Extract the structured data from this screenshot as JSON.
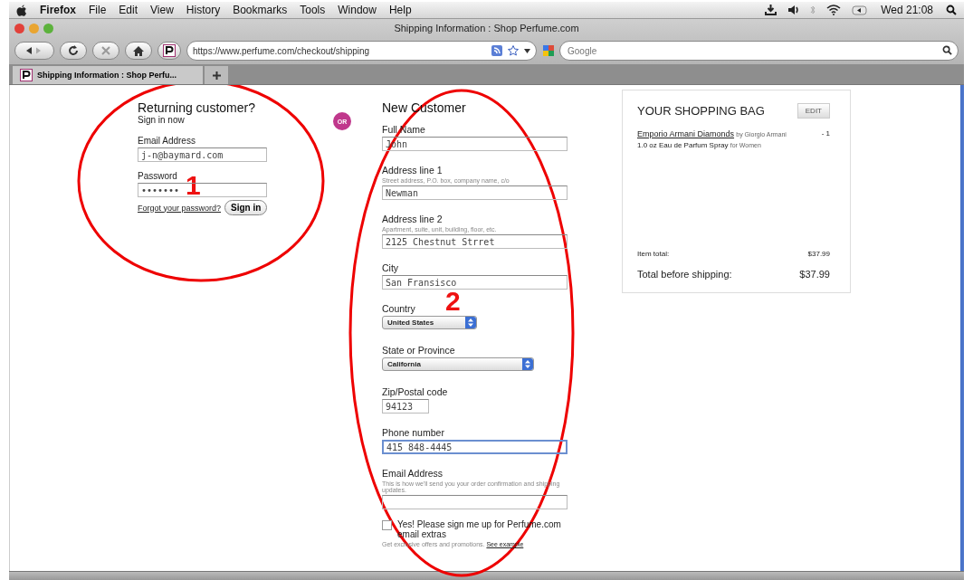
{
  "menu_bar": {
    "items": [
      "Firefox",
      "File",
      "Edit",
      "View",
      "History",
      "Bookmarks",
      "Tools",
      "Window",
      "Help"
    ],
    "clock": "Wed 21:08"
  },
  "window": {
    "title": "Shipping Information : Shop Perfume.com"
  },
  "toolbar": {
    "url": "https://www.perfume.com/checkout/shipping",
    "search_placeholder": "Google"
  },
  "tabs": [
    {
      "label": "Shipping Information : Shop Perfu...",
      "selected": true
    }
  ],
  "returning": {
    "title": "Returning customer?",
    "subtitle": "Sign in now",
    "fields": [
      {
        "label": "Email Address",
        "value": "j-n@baymard.com"
      },
      {
        "label": "Password",
        "value": "•••••••"
      }
    ],
    "forgot_link": "Forgot your password?",
    "sign_in_button": "Sign in"
  },
  "or_badge": "OR",
  "new_customer": {
    "title": "New Customer",
    "fields": [
      {
        "kind": "text",
        "label": "Full Name",
        "value": "John"
      },
      {
        "kind": "text",
        "label": "Address line 1",
        "hint": "Street address, P.O. box, company name, c/o",
        "value": "Newman"
      },
      {
        "kind": "text",
        "label": "Address line 2",
        "hint": "Apartment, suite, unit, building, floor, etc.",
        "value": "2125 Chestnut Strret"
      },
      {
        "kind": "text",
        "label": "City",
        "value": "San Fransisco"
      },
      {
        "kind": "select",
        "label": "Country",
        "value": "United States"
      },
      {
        "kind": "select",
        "label": "State or Province",
        "value": "California"
      },
      {
        "kind": "text",
        "label": "Zip/Postal code",
        "value": "94123"
      },
      {
        "kind": "text",
        "label": "Phone number",
        "value": "415 848-4445",
        "focused": true
      },
      {
        "kind": "text",
        "label": "Email Address",
        "hint": "This is how we'll send you your order confirmation and shipping updates."
      }
    ],
    "newsletter": {
      "label": "Yes! Please sign me up for Perfume.com email extras",
      "checked": false,
      "note": "Get exclusive offers and promotions.",
      "link": "See example"
    }
  },
  "bag": {
    "title": "YOUR SHOPPING BAG",
    "edit_button": "EDIT",
    "item": {
      "name": "Emporio Armani Diamonds",
      "brand": "by Giorgio Armani",
      "quantity": "- 1",
      "description": "1.0 oz Eau de Parfum Spray",
      "note": "for Women"
    },
    "totals": [
      {
        "kind": "sub",
        "label": "Item total:",
        "value": "$37.99"
      },
      {
        "kind": "grand",
        "label": "Total before shipping:",
        "value": "$37.99"
      }
    ]
  },
  "annotations": [
    {
      "number": "1"
    },
    {
      "number": "2"
    }
  ]
}
